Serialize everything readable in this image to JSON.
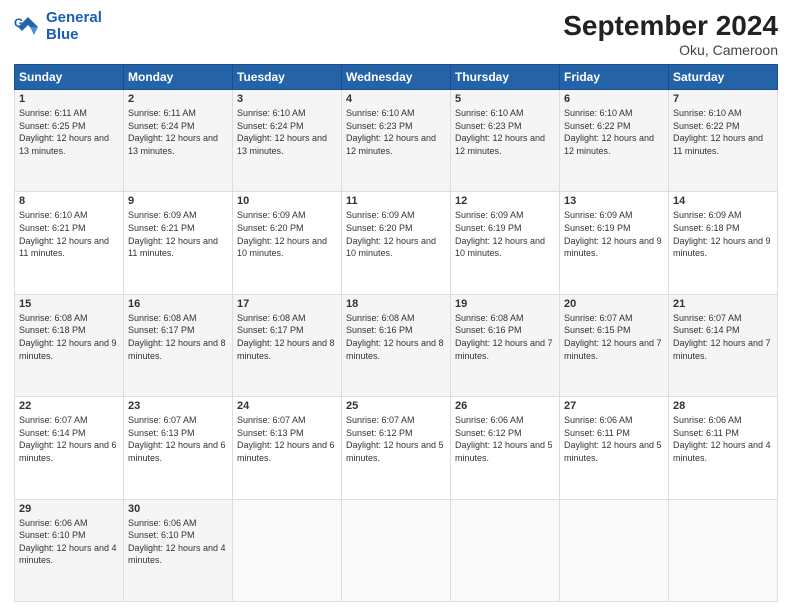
{
  "header": {
    "logo_line1": "General",
    "logo_line2": "Blue",
    "title": "September 2024",
    "subtitle": "Oku, Cameroon"
  },
  "days": [
    "Sunday",
    "Monday",
    "Tuesday",
    "Wednesday",
    "Thursday",
    "Friday",
    "Saturday"
  ],
  "weeks": [
    [
      {
        "day": "1",
        "text": "Sunrise: 6:11 AM\nSunset: 6:25 PM\nDaylight: 12 hours and 13 minutes."
      },
      {
        "day": "2",
        "text": "Sunrise: 6:11 AM\nSunset: 6:24 PM\nDaylight: 12 hours and 13 minutes."
      },
      {
        "day": "3",
        "text": "Sunrise: 6:10 AM\nSunset: 6:24 PM\nDaylight: 12 hours and 13 minutes."
      },
      {
        "day": "4",
        "text": "Sunrise: 6:10 AM\nSunset: 6:23 PM\nDaylight: 12 hours and 12 minutes."
      },
      {
        "day": "5",
        "text": "Sunrise: 6:10 AM\nSunset: 6:23 PM\nDaylight: 12 hours and 12 minutes."
      },
      {
        "day": "6",
        "text": "Sunrise: 6:10 AM\nSunset: 6:22 PM\nDaylight: 12 hours and 12 minutes."
      },
      {
        "day": "7",
        "text": "Sunrise: 6:10 AM\nSunset: 6:22 PM\nDaylight: 12 hours and 11 minutes."
      }
    ],
    [
      {
        "day": "8",
        "text": "Sunrise: 6:10 AM\nSunset: 6:21 PM\nDaylight: 12 hours and 11 minutes."
      },
      {
        "day": "9",
        "text": "Sunrise: 6:09 AM\nSunset: 6:21 PM\nDaylight: 12 hours and 11 minutes."
      },
      {
        "day": "10",
        "text": "Sunrise: 6:09 AM\nSunset: 6:20 PM\nDaylight: 12 hours and 10 minutes."
      },
      {
        "day": "11",
        "text": "Sunrise: 6:09 AM\nSunset: 6:20 PM\nDaylight: 12 hours and 10 minutes."
      },
      {
        "day": "12",
        "text": "Sunrise: 6:09 AM\nSunset: 6:19 PM\nDaylight: 12 hours and 10 minutes."
      },
      {
        "day": "13",
        "text": "Sunrise: 6:09 AM\nSunset: 6:19 PM\nDaylight: 12 hours and 9 minutes."
      },
      {
        "day": "14",
        "text": "Sunrise: 6:09 AM\nSunset: 6:18 PM\nDaylight: 12 hours and 9 minutes."
      }
    ],
    [
      {
        "day": "15",
        "text": "Sunrise: 6:08 AM\nSunset: 6:18 PM\nDaylight: 12 hours and 9 minutes."
      },
      {
        "day": "16",
        "text": "Sunrise: 6:08 AM\nSunset: 6:17 PM\nDaylight: 12 hours and 8 minutes."
      },
      {
        "day": "17",
        "text": "Sunrise: 6:08 AM\nSunset: 6:17 PM\nDaylight: 12 hours and 8 minutes."
      },
      {
        "day": "18",
        "text": "Sunrise: 6:08 AM\nSunset: 6:16 PM\nDaylight: 12 hours and 8 minutes."
      },
      {
        "day": "19",
        "text": "Sunrise: 6:08 AM\nSunset: 6:16 PM\nDaylight: 12 hours and 7 minutes."
      },
      {
        "day": "20",
        "text": "Sunrise: 6:07 AM\nSunset: 6:15 PM\nDaylight: 12 hours and 7 minutes."
      },
      {
        "day": "21",
        "text": "Sunrise: 6:07 AM\nSunset: 6:14 PM\nDaylight: 12 hours and 7 minutes."
      }
    ],
    [
      {
        "day": "22",
        "text": "Sunrise: 6:07 AM\nSunset: 6:14 PM\nDaylight: 12 hours and 6 minutes."
      },
      {
        "day": "23",
        "text": "Sunrise: 6:07 AM\nSunset: 6:13 PM\nDaylight: 12 hours and 6 minutes."
      },
      {
        "day": "24",
        "text": "Sunrise: 6:07 AM\nSunset: 6:13 PM\nDaylight: 12 hours and 6 minutes."
      },
      {
        "day": "25",
        "text": "Sunrise: 6:07 AM\nSunset: 6:12 PM\nDaylight: 12 hours and 5 minutes."
      },
      {
        "day": "26",
        "text": "Sunrise: 6:06 AM\nSunset: 6:12 PM\nDaylight: 12 hours and 5 minutes."
      },
      {
        "day": "27",
        "text": "Sunrise: 6:06 AM\nSunset: 6:11 PM\nDaylight: 12 hours and 5 minutes."
      },
      {
        "day": "28",
        "text": "Sunrise: 6:06 AM\nSunset: 6:11 PM\nDaylight: 12 hours and 4 minutes."
      }
    ],
    [
      {
        "day": "29",
        "text": "Sunrise: 6:06 AM\nSunset: 6:10 PM\nDaylight: 12 hours and 4 minutes."
      },
      {
        "day": "30",
        "text": "Sunrise: 6:06 AM\nSunset: 6:10 PM\nDaylight: 12 hours and 4 minutes."
      },
      {
        "day": "",
        "text": ""
      },
      {
        "day": "",
        "text": ""
      },
      {
        "day": "",
        "text": ""
      },
      {
        "day": "",
        "text": ""
      },
      {
        "day": "",
        "text": ""
      }
    ]
  ]
}
